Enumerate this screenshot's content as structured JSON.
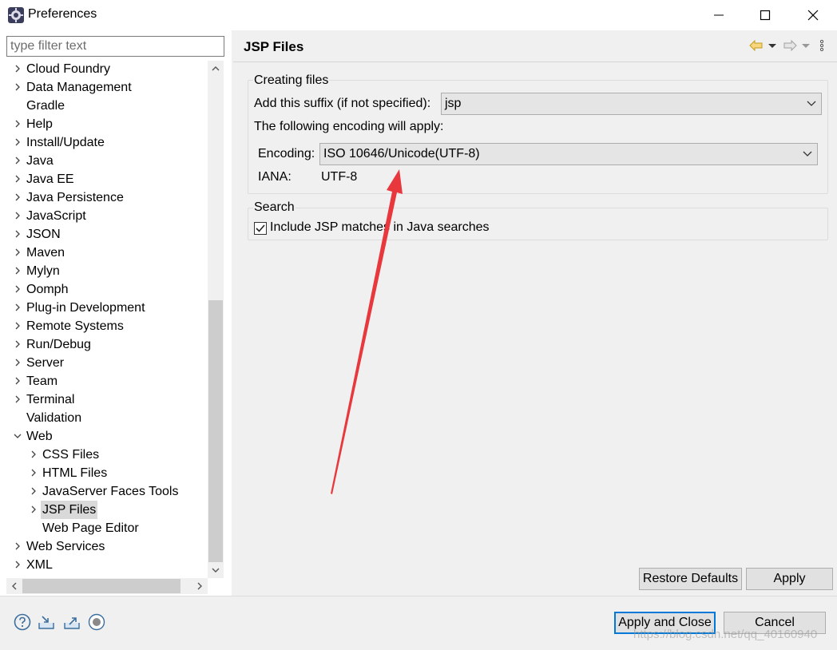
{
  "window": {
    "title": "Preferences",
    "icon": "eclipse-gear-icon",
    "controls": [
      "minimize-icon",
      "maximize-icon",
      "close-icon"
    ]
  },
  "sidebar": {
    "filter_placeholder": "type filter text",
    "items": [
      {
        "label": "Cloud Foundry",
        "expandable": true,
        "expanded": false,
        "level": 0
      },
      {
        "label": "Data Management",
        "expandable": true,
        "expanded": false,
        "level": 0
      },
      {
        "label": "Gradle",
        "expandable": false,
        "level": 0
      },
      {
        "label": "Help",
        "expandable": true,
        "expanded": false,
        "level": 0
      },
      {
        "label": "Install/Update",
        "expandable": true,
        "expanded": false,
        "level": 0
      },
      {
        "label": "Java",
        "expandable": true,
        "expanded": false,
        "level": 0
      },
      {
        "label": "Java EE",
        "expandable": true,
        "expanded": false,
        "level": 0
      },
      {
        "label": "Java Persistence",
        "expandable": true,
        "expanded": false,
        "level": 0
      },
      {
        "label": "JavaScript",
        "expandable": true,
        "expanded": false,
        "level": 0
      },
      {
        "label": "JSON",
        "expandable": true,
        "expanded": false,
        "level": 0
      },
      {
        "label": "Maven",
        "expandable": true,
        "expanded": false,
        "level": 0
      },
      {
        "label": "Mylyn",
        "expandable": true,
        "expanded": false,
        "level": 0
      },
      {
        "label": "Oomph",
        "expandable": true,
        "expanded": false,
        "level": 0
      },
      {
        "label": "Plug-in Development",
        "expandable": true,
        "expanded": false,
        "level": 0
      },
      {
        "label": "Remote Systems",
        "expandable": true,
        "expanded": false,
        "level": 0
      },
      {
        "label": "Run/Debug",
        "expandable": true,
        "expanded": false,
        "level": 0
      },
      {
        "label": "Server",
        "expandable": true,
        "expanded": false,
        "level": 0
      },
      {
        "label": "Team",
        "expandable": true,
        "expanded": false,
        "level": 0
      },
      {
        "label": "Terminal",
        "expandable": true,
        "expanded": false,
        "level": 0
      },
      {
        "label": "Validation",
        "expandable": false,
        "level": 0
      },
      {
        "label": "Web",
        "expandable": true,
        "expanded": true,
        "level": 0
      },
      {
        "label": "CSS Files",
        "expandable": true,
        "expanded": false,
        "level": 1
      },
      {
        "label": "HTML Files",
        "expandable": true,
        "expanded": false,
        "level": 1
      },
      {
        "label": "JavaServer Faces Tools",
        "expandable": true,
        "expanded": false,
        "level": 1
      },
      {
        "label": "JSP Files",
        "expandable": true,
        "expanded": false,
        "level": 1,
        "selected": true
      },
      {
        "label": "Web Page Editor",
        "expandable": false,
        "level": 1
      },
      {
        "label": "Web Services",
        "expandable": true,
        "expanded": false,
        "level": 0
      },
      {
        "label": "XML",
        "expandable": true,
        "expanded": false,
        "level": 0
      }
    ]
  },
  "page": {
    "title": "JSP Files",
    "nav_icons": [
      "back-arrow-icon",
      "back-menu-icon",
      "forward-arrow-icon",
      "forward-menu-icon",
      "view-menu-icon"
    ],
    "creating_files": {
      "group_title": "Creating files",
      "suffix_label": "Add this suffix (if not specified):",
      "suffix_value": "jsp",
      "encoding_note": "The following encoding will apply:",
      "encoding_label": "Encoding:",
      "encoding_value": "ISO 10646/Unicode(UTF-8)",
      "iana_label": "IANA:",
      "iana_value": "UTF-8"
    },
    "search": {
      "group_title": "Search",
      "include_jsp_label": "Include JSP matches in Java searches",
      "include_jsp_checked": true
    },
    "restore_defaults_label": "Restore Defaults",
    "apply_label": "Apply"
  },
  "footer": {
    "icons": [
      "help-icon",
      "import-icon",
      "export-icon",
      "record-icon"
    ],
    "apply_close_label": "Apply and Close",
    "cancel_label": "Cancel",
    "watermark": "https://blog.csdn.net/qq_40160940"
  },
  "annotation": {
    "arrow_color": "#e8383d"
  }
}
